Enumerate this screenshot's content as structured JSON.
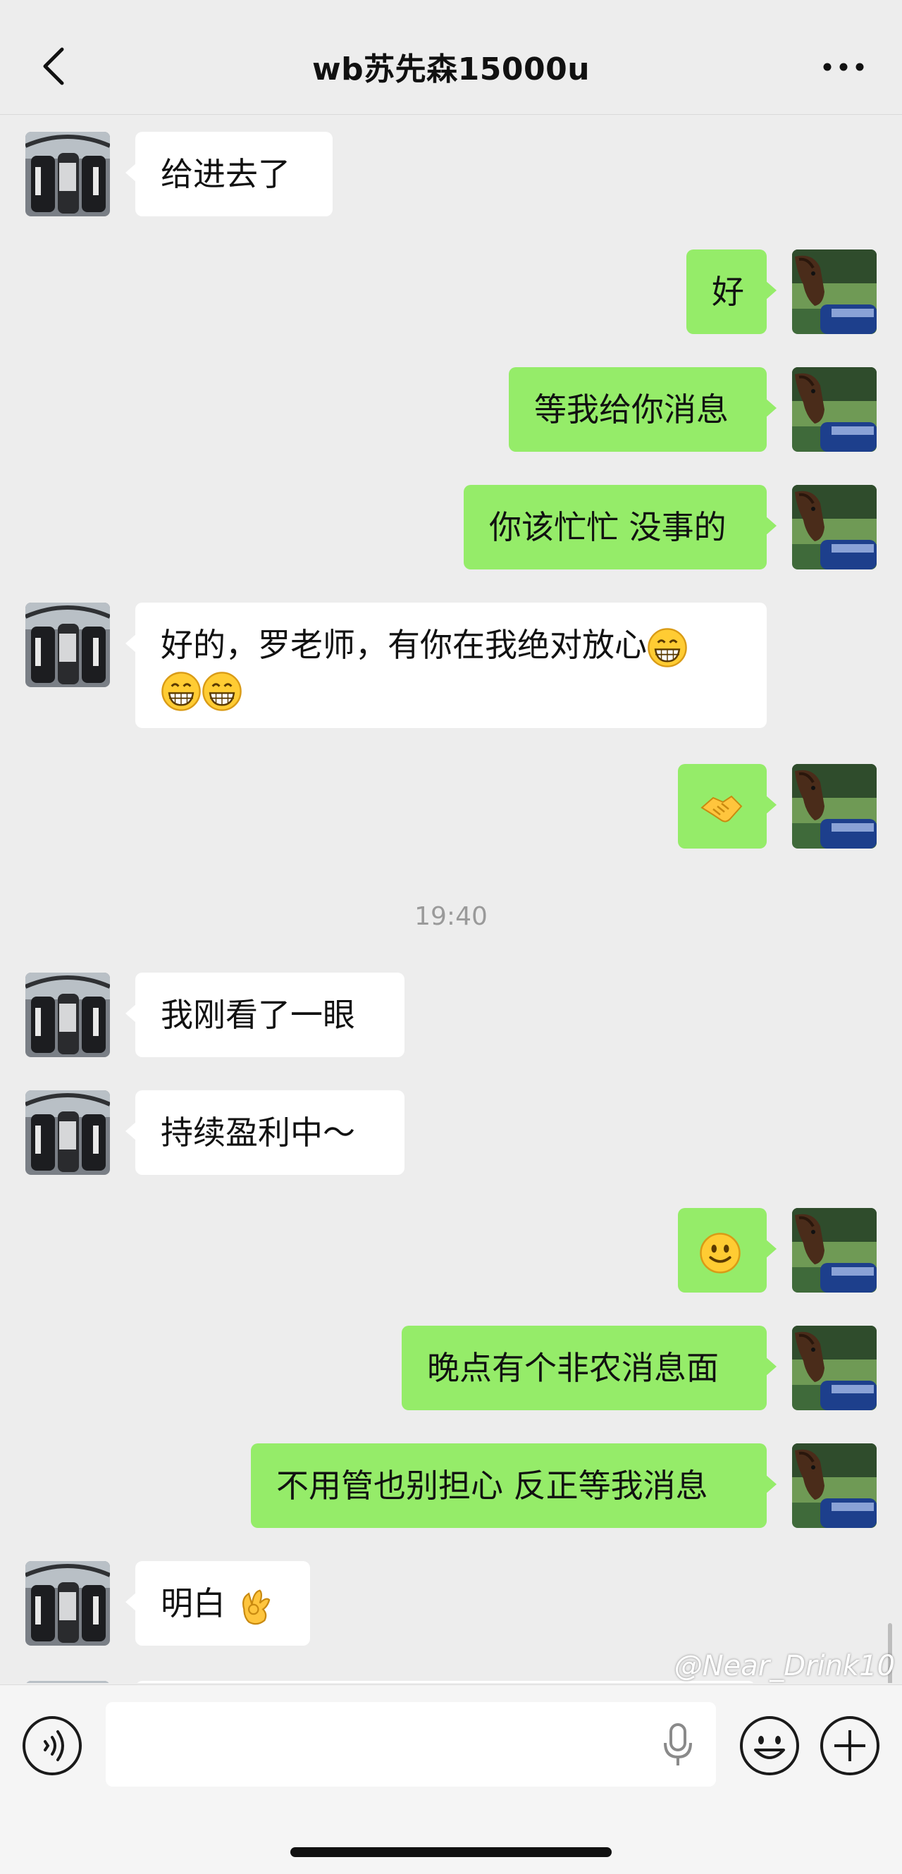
{
  "header": {
    "title": "wb苏先森15000u"
  },
  "messages": [
    {
      "side": "in",
      "text": "给进去了"
    },
    {
      "side": "out",
      "text": "好"
    },
    {
      "side": "out",
      "text": "等我给你消息"
    },
    {
      "side": "out",
      "text": "你该忙忙 没事的"
    },
    {
      "side": "in",
      "text": "好的，罗老师，有你在我绝对放心",
      "trailing_emoji": "grin-emoji x3"
    },
    {
      "side": "out",
      "emoji": "handshake-emoji"
    },
    {
      "time": "19:40"
    },
    {
      "side": "in",
      "text": "我刚看了一眼"
    },
    {
      "side": "in",
      "text": "持续盈利中～"
    },
    {
      "side": "out",
      "emoji": "smile-emoji"
    },
    {
      "side": "out",
      "text": "晚点有个非农消息面"
    },
    {
      "side": "out",
      "text": "不用管也别担心 反正等我消息"
    },
    {
      "side": "in",
      "text": "明白",
      "trailing_emoji": "ok-hand-emoji"
    }
  ],
  "watermark": "@Near_Drink10",
  "colors": {
    "background": "#ededed",
    "outgoing_bubble": "#95ec69",
    "incoming_bubble": "#ffffff"
  },
  "icons": [
    "back-arrow-icon",
    "more-dots-icon",
    "voice-icon",
    "mic-icon",
    "emoji-icon",
    "plus-icon"
  ]
}
